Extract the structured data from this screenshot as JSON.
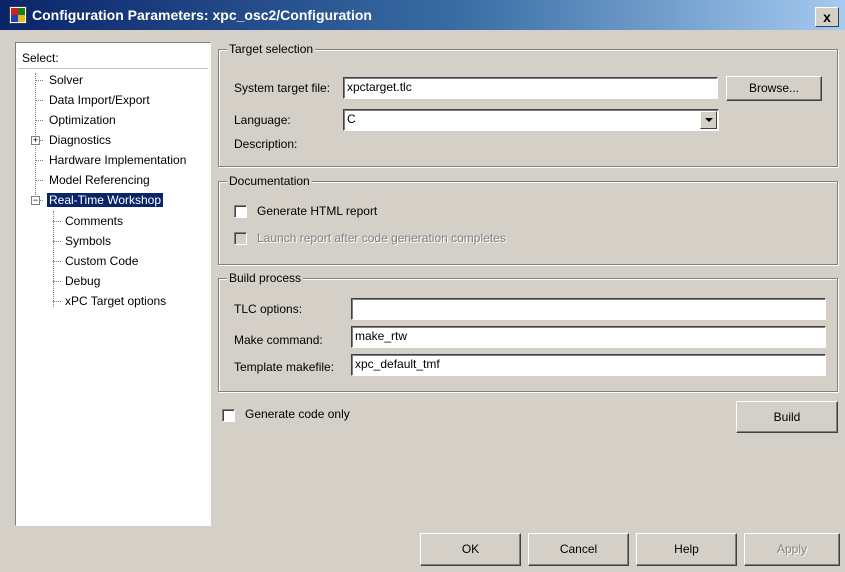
{
  "window": {
    "title": "Configuration Parameters: xpc_osc2/Configuration",
    "close_label": "x"
  },
  "tree": {
    "header": "Select:",
    "items": [
      {
        "label": "Solver"
      },
      {
        "label": "Data Import/Export"
      },
      {
        "label": "Optimization"
      },
      {
        "label": "Diagnostics"
      },
      {
        "label": "Hardware Implementation"
      },
      {
        "label": "Model Referencing"
      },
      {
        "label": "Real-Time Workshop",
        "selected": true
      },
      {
        "label": "Comments"
      },
      {
        "label": "Symbols"
      },
      {
        "label": "Custom Code"
      },
      {
        "label": "Debug"
      },
      {
        "label": "xPC Target options"
      }
    ]
  },
  "target_selection": {
    "legend": "Target selection",
    "system_target_label": "System target file:",
    "system_target_value": "xpctarget.tlc",
    "browse_label": "Browse...",
    "language_label": "Language:",
    "language_value": "C",
    "description_label": "Description:"
  },
  "documentation": {
    "legend": "Documentation",
    "generate_html_label": "Generate HTML report",
    "launch_report_label": "Launch report after code generation completes"
  },
  "build_process": {
    "legend": "Build process",
    "tlc_options_label": "TLC options:",
    "tlc_options_value": "",
    "make_command_label": "Make command:",
    "make_command_value": "make_rtw",
    "template_makefile_label": "Template makefile:",
    "template_makefile_value": "xpc_default_tmf"
  },
  "generate_code_only_label": "Generate code only",
  "build_label": "Build",
  "buttons": {
    "ok": "OK",
    "cancel": "Cancel",
    "help": "Help",
    "apply": "Apply"
  }
}
